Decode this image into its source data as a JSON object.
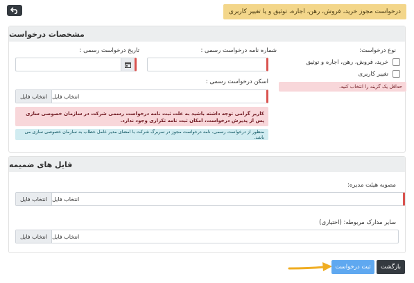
{
  "header": {
    "title": "درخواست مجوز خرید، فروش، رهن، اجاره، توثیق و یا تغییر کاربری",
    "back_icon": "undo-arrow-icon"
  },
  "request_section": {
    "title": "مشخصات درخواست",
    "request_type_label": "نوع درخواست:",
    "option_1": "خرید، فروش، رهن، اجاره و توثیق",
    "option_2": "تغییر کاربری",
    "option_error": "حداقل یک گزینه را انتخاب کنید.",
    "letter_number_label": "شماره نامه درخواست رسمی :",
    "letter_number_value": "",
    "letter_date_label": "تاریخ درخواست رسمی :",
    "letter_date_value": "",
    "scan_label": "اسکن درخواست رسمی :",
    "scan_placeholder": "انتخاب فایل",
    "scan_button": "انتخاب فایل",
    "warning": "کاربر گرامی توجه داشته باشید به علت ثبت نامه درخواست رسمی شرکت در سازمان خصوصی سازی پس از پذیرش درخواست، امکان ثبت نامه تکراری وجود ندارد.",
    "info": "منظور از درخواست رسمی، نامه درخواست مجوز در سربرگ شرکت با امضای مدیر عامل خطاب به سازمان خصوصی سازی می باشد."
  },
  "attachments_section": {
    "title": "فایل های ضمیمه",
    "board_label": "مصوبه هیئت مدیره:",
    "board_placeholder": "انتخاب فایل",
    "board_button": "انتخاب فایل",
    "other_label": "سایر مدارک مربوطه: (اختیاری)",
    "other_placeholder": "انتخاب فایل",
    "other_button": "انتخاب فایل"
  },
  "actions": {
    "back_label": "بازگشت",
    "submit_label": "ثبت درخواست"
  },
  "colors": {
    "submit": "#5fa8f0",
    "back": "#343a40",
    "required_marker": "#d9534f",
    "arrow": "#f0ad22"
  }
}
